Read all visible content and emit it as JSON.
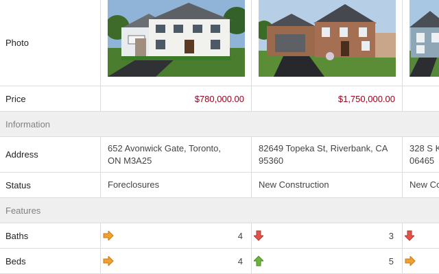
{
  "rows": {
    "photo_label": "Photo",
    "price_label": "Price",
    "information_label": "Information",
    "address_label": "Address",
    "status_label": "Status",
    "features_label": "Features",
    "baths_label": "Baths",
    "beds_label": "Beds"
  },
  "listings": [
    {
      "price": "$780,000.00",
      "address_line1": "652 Avonwick Gate, Toronto,",
      "address_line2": "ON M3A25",
      "status": "Foreclosures",
      "baths": "4",
      "baths_trend": "right-arrow-icon",
      "beds": "4",
      "beds_trend": "right-arrow-icon"
    },
    {
      "price": "$1,750,000.00",
      "address_line1": "82649 Topeka St, Riverbank, CA",
      "address_line2": "95360",
      "status": "New Construction",
      "baths": "3",
      "baths_trend": "down-arrow-icon",
      "beds": "5",
      "beds_trend": "up-arrow-icon"
    },
    {
      "address_line1": "328 S K",
      "address_line2": "06465",
      "status": "New Co",
      "baths_trend": "down-arrow-icon",
      "beds_trend": "right-arrow-icon"
    }
  ],
  "colors": {
    "price": "#a0001c",
    "arrow_up": "#6db33f",
    "arrow_down": "#e0524a",
    "arrow_right": "#f0a030"
  }
}
